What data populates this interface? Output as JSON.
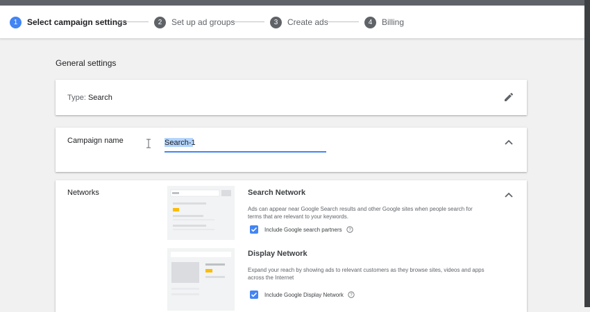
{
  "stepper": {
    "steps": [
      {
        "num": "1",
        "label": "Select campaign settings"
      },
      {
        "num": "2",
        "label": "Set up ad groups"
      },
      {
        "num": "3",
        "label": "Create ads"
      },
      {
        "num": "4",
        "label": "Billing"
      }
    ],
    "active_step": 1
  },
  "section_title": "General settings",
  "type_card": {
    "prefix": "Type:",
    "value": "Search",
    "icon": "pencil-icon"
  },
  "campaign_name": {
    "label": "Campaign name",
    "value": "Search-1"
  },
  "networks": {
    "label": "Networks",
    "search": {
      "title": "Search Network",
      "description": "Ads can appear near Google Search results and other Google sites when people search for terms that are relevant to your keywords.",
      "checkbox_label": "Include Google search partners",
      "checked": true
    },
    "display": {
      "title": "Display Network",
      "description": "Expand your reach by showing ads to relevant customers as they browse sites, videos and apps across the Internet",
      "checkbox_label": "Include Google Display Network",
      "checked": true
    }
  },
  "colors": {
    "accent": "#4285f4",
    "step_inactive": "#5f6368",
    "ad_highlight": "#fbbc04"
  }
}
